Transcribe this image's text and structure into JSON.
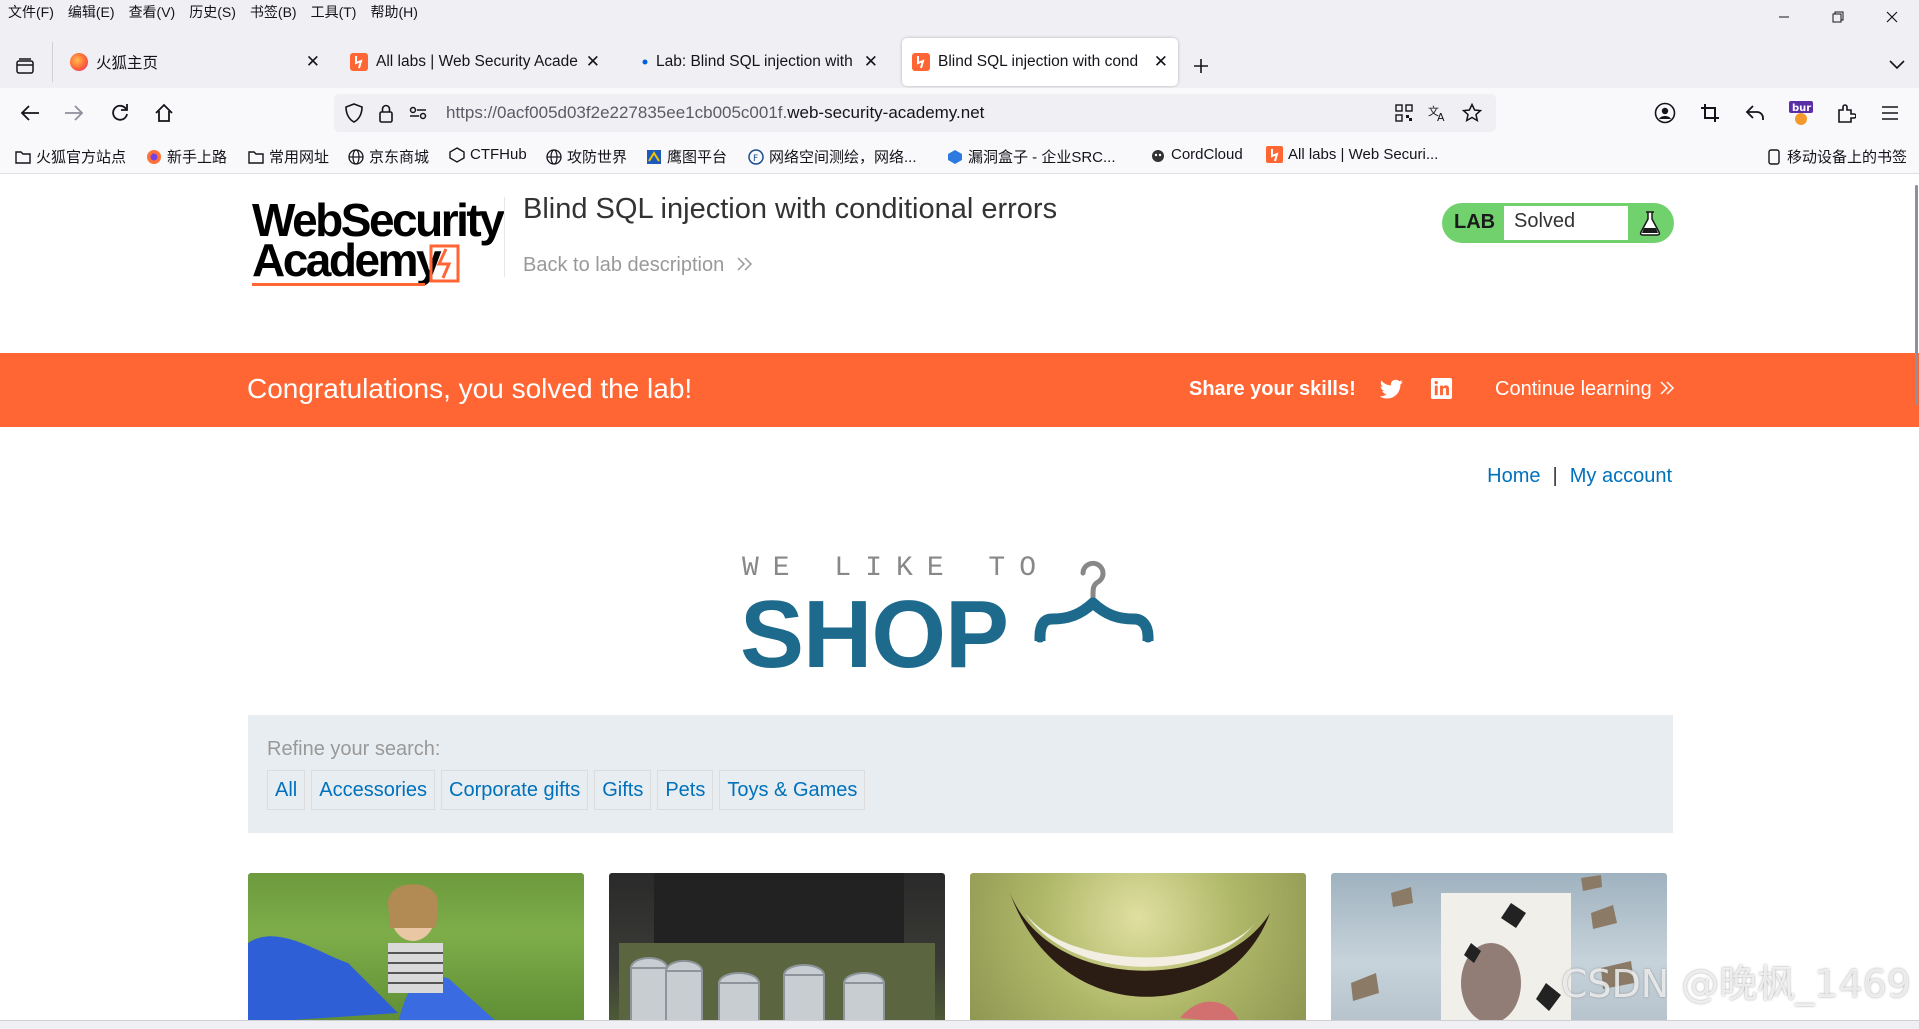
{
  "menubar": [
    "文件(F)",
    "编辑(E)",
    "查看(V)",
    "历史(S)",
    "书签(B)",
    "工具(T)",
    "帮助(H)"
  ],
  "tabs": [
    {
      "title": "火狐主页",
      "favicon": "firefox-icon"
    },
    {
      "title": "All labs | Web Security Acade",
      "favicon": "portswigger-icon"
    },
    {
      "title": "Lab: Blind SQL injection with",
      "favicon": "dot"
    },
    {
      "title": "Blind SQL injection with cond",
      "favicon": "portswigger-icon",
      "active": true
    }
  ],
  "urlbar": {
    "url_prefix": "https://0acf005d03f2e227835ee1cb005c001f.",
    "url_domain": "web-security-academy.net"
  },
  "bookmarks": [
    {
      "label": "火狐官方站点",
      "icon": "folder-icon"
    },
    {
      "label": "新手上路",
      "icon": "firefox-icon"
    },
    {
      "label": "常用网址",
      "icon": "folder-icon"
    },
    {
      "label": "京东商城",
      "icon": "globe-icon"
    },
    {
      "label": "CTFHub",
      "icon": "ctfhub-icon"
    },
    {
      "label": "攻防世界",
      "icon": "globe-icon"
    },
    {
      "label": "鹰图平台",
      "icon": "hunter-icon"
    },
    {
      "label": "网络空间测绘，网络...",
      "icon": "fofa-icon"
    },
    {
      "label": "漏洞盒子 - 企业SRC...",
      "icon": "vulbox-icon"
    },
    {
      "label": "CordCloud",
      "icon": "cordcloud-icon"
    },
    {
      "label": "All labs | Web Securi...",
      "icon": "portswigger-icon"
    },
    {
      "label": "移动设备上的书签",
      "icon": "mobile-icon"
    }
  ],
  "header": {
    "logo_line1": "WebSecurity",
    "logo_line2": "Academy",
    "lab_title": "Blind SQL injection with conditional errors",
    "back_link": "Back to lab description",
    "status_badge_label": "LAB",
    "status_value": "Solved"
  },
  "banner": {
    "message": "Congratulations, you solved the lab!",
    "share_label": "Share your skills!",
    "continue_label": "Continue learning"
  },
  "nav": {
    "home": "Home",
    "separator": "|",
    "account": "My account"
  },
  "shop_logo": {
    "tagline": "WE LIKE TO",
    "word": "SHOP"
  },
  "filter": {
    "label": "Refine your search:",
    "categories": [
      "All",
      "Accessories",
      "Corporate gifts",
      "Gifts",
      "Pets",
      "Toys & Games"
    ]
  },
  "watermark": "CSDN @晚枫_1469",
  "colors": {
    "accent_orange": "#ff6633",
    "link_blue": "#0071bc",
    "solved_green": "#70d16d",
    "shop_blue": "#1e6a8d"
  }
}
